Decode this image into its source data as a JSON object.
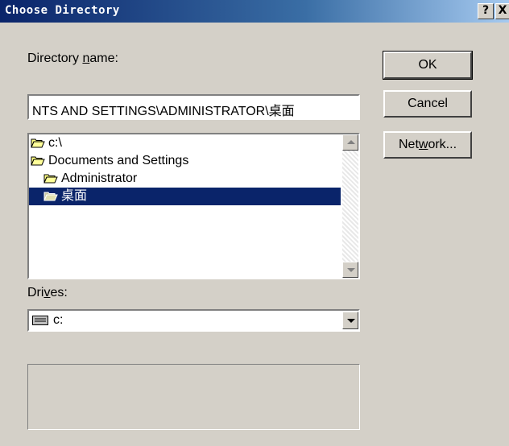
{
  "window": {
    "title": "Choose Directory",
    "help_label": "?",
    "close_label": "X"
  },
  "labels": {
    "dir_name_pre": "Directory ",
    "dir_name_key": "n",
    "dir_name_post": "ame:",
    "drives_pre": "Dri",
    "drives_key": "v",
    "drives_post": "es:"
  },
  "dir_input": {
    "value": "NTS AND SETTINGS\\ADMINISTRATOR\\桌面"
  },
  "tree": [
    {
      "label": "c:\\"
    },
    {
      "label": "Documents and Settings"
    },
    {
      "label": "Administrator"
    },
    {
      "label": "桌面",
      "selected": true
    }
  ],
  "drive": {
    "value": "c:"
  },
  "buttons": {
    "ok": "OK",
    "cancel": "Cancel",
    "network_pre": "Net",
    "network_key": "w",
    "network_post": "ork..."
  },
  "icons": {
    "folder_open": "folder-open-icon",
    "drive": "drive-icon"
  }
}
